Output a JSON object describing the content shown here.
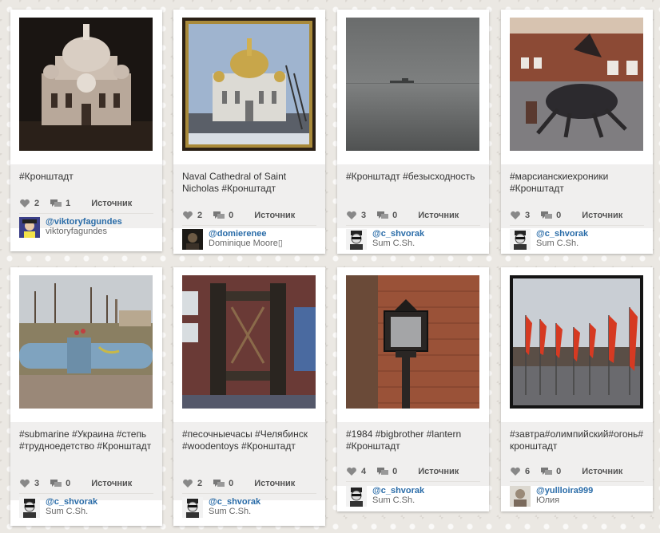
{
  "cards": [
    {
      "caption": "#Кронштадт",
      "likes": "2",
      "comments": "1",
      "source_label": "Источник",
      "username": "@viktoryfagundes",
      "realname": "viktoryfagundes",
      "photo_desc": "cathedral-night"
    },
    {
      "caption": "Naval Cathedral of Saint Nicholas #Кронштадт",
      "likes": "2",
      "comments": "0",
      "source_label": "Источник",
      "username": "@domierenee",
      "realname": "Dominique Moore▯",
      "photo_desc": "cathedral-day"
    },
    {
      "caption": "#Кронштадт #безысходность",
      "likes": "3",
      "comments": "0",
      "source_label": "Источник",
      "username": "@c_shvorak",
      "realname": "Sum C.Sh.",
      "photo_desc": "foggy-sea"
    },
    {
      "caption": "#марсианскиехроники #Кронштадт",
      "likes": "3",
      "comments": "0",
      "source_label": "Источник",
      "username": "@c_shvorak",
      "realname": "Sum C.Sh.",
      "photo_desc": "sculpture-yard"
    },
    {
      "caption": "#submarine #Украина #степь #трудноедетство #Кронштадт",
      "likes": "3",
      "comments": "0",
      "source_label": "Источник",
      "username": "@c_shvorak",
      "realname": "Sum C.Sh.",
      "photo_desc": "painted-pipe"
    },
    {
      "caption": "#песочныечасы #Челябинск #woodentoys #Кронштадт",
      "likes": "2",
      "comments": "0",
      "source_label": "Источник",
      "username": "@c_shvorak",
      "realname": "Sum C.Sh.",
      "photo_desc": "wooden-gate"
    },
    {
      "caption": "#1984 #bigbrother #lantern #Кронштадт",
      "likes": "4",
      "comments": "0",
      "source_label": "Источник",
      "username": "@c_shvorak",
      "realname": "Sum C.Sh.",
      "photo_desc": "lantern-brick"
    },
    {
      "caption": "#завтра#олимпийский#огонь#кронштадт",
      "likes": "6",
      "comments": "0",
      "source_label": "Источник",
      "username": "@yullloira999",
      "realname": "Юлия",
      "photo_desc": "red-flags"
    }
  ],
  "colors": {
    "link": "#2a6ca8",
    "caption_bg": "#f0efee",
    "card_bg": "#ffffff"
  }
}
